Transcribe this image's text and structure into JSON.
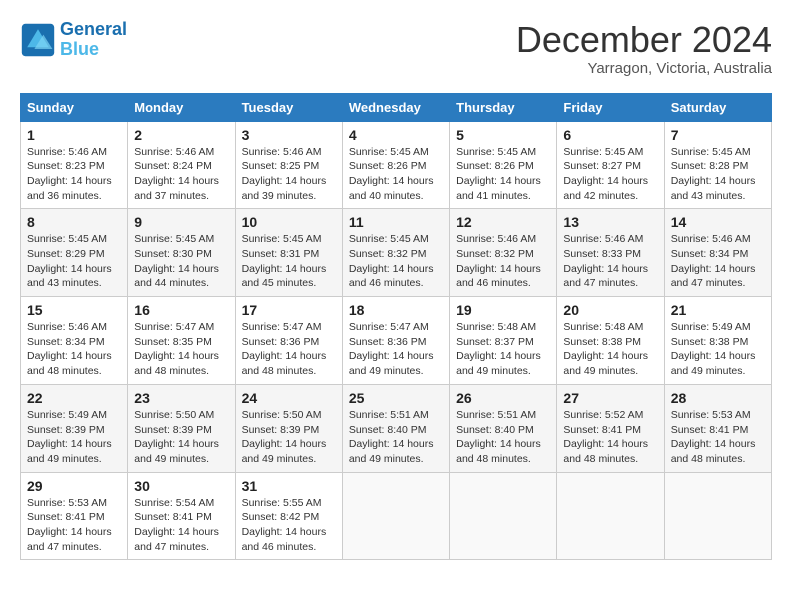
{
  "header": {
    "logo_line1": "General",
    "logo_line2": "Blue",
    "month_title": "December 2024",
    "location": "Yarragon, Victoria, Australia"
  },
  "days_of_week": [
    "Sunday",
    "Monday",
    "Tuesday",
    "Wednesday",
    "Thursday",
    "Friday",
    "Saturday"
  ],
  "weeks": [
    [
      {
        "day": "1",
        "lines": [
          "Sunrise: 5:46 AM",
          "Sunset: 8:23 PM",
          "Daylight: 14 hours",
          "and 36 minutes."
        ]
      },
      {
        "day": "2",
        "lines": [
          "Sunrise: 5:46 AM",
          "Sunset: 8:24 PM",
          "Daylight: 14 hours",
          "and 37 minutes."
        ]
      },
      {
        "day": "3",
        "lines": [
          "Sunrise: 5:46 AM",
          "Sunset: 8:25 PM",
          "Daylight: 14 hours",
          "and 39 minutes."
        ]
      },
      {
        "day": "4",
        "lines": [
          "Sunrise: 5:45 AM",
          "Sunset: 8:26 PM",
          "Daylight: 14 hours",
          "and 40 minutes."
        ]
      },
      {
        "day": "5",
        "lines": [
          "Sunrise: 5:45 AM",
          "Sunset: 8:26 PM",
          "Daylight: 14 hours",
          "and 41 minutes."
        ]
      },
      {
        "day": "6",
        "lines": [
          "Sunrise: 5:45 AM",
          "Sunset: 8:27 PM",
          "Daylight: 14 hours",
          "and 42 minutes."
        ]
      },
      {
        "day": "7",
        "lines": [
          "Sunrise: 5:45 AM",
          "Sunset: 8:28 PM",
          "Daylight: 14 hours",
          "and 43 minutes."
        ]
      }
    ],
    [
      {
        "day": "8",
        "lines": [
          "Sunrise: 5:45 AM",
          "Sunset: 8:29 PM",
          "Daylight: 14 hours",
          "and 43 minutes."
        ]
      },
      {
        "day": "9",
        "lines": [
          "Sunrise: 5:45 AM",
          "Sunset: 8:30 PM",
          "Daylight: 14 hours",
          "and 44 minutes."
        ]
      },
      {
        "day": "10",
        "lines": [
          "Sunrise: 5:45 AM",
          "Sunset: 8:31 PM",
          "Daylight: 14 hours",
          "and 45 minutes."
        ]
      },
      {
        "day": "11",
        "lines": [
          "Sunrise: 5:45 AM",
          "Sunset: 8:32 PM",
          "Daylight: 14 hours",
          "and 46 minutes."
        ]
      },
      {
        "day": "12",
        "lines": [
          "Sunrise: 5:46 AM",
          "Sunset: 8:32 PM",
          "Daylight: 14 hours",
          "and 46 minutes."
        ]
      },
      {
        "day": "13",
        "lines": [
          "Sunrise: 5:46 AM",
          "Sunset: 8:33 PM",
          "Daylight: 14 hours",
          "and 47 minutes."
        ]
      },
      {
        "day": "14",
        "lines": [
          "Sunrise: 5:46 AM",
          "Sunset: 8:34 PM",
          "Daylight: 14 hours",
          "and 47 minutes."
        ]
      }
    ],
    [
      {
        "day": "15",
        "lines": [
          "Sunrise: 5:46 AM",
          "Sunset: 8:34 PM",
          "Daylight: 14 hours",
          "and 48 minutes."
        ]
      },
      {
        "day": "16",
        "lines": [
          "Sunrise: 5:47 AM",
          "Sunset: 8:35 PM",
          "Daylight: 14 hours",
          "and 48 minutes."
        ]
      },
      {
        "day": "17",
        "lines": [
          "Sunrise: 5:47 AM",
          "Sunset: 8:36 PM",
          "Daylight: 14 hours",
          "and 48 minutes."
        ]
      },
      {
        "day": "18",
        "lines": [
          "Sunrise: 5:47 AM",
          "Sunset: 8:36 PM",
          "Daylight: 14 hours",
          "and 49 minutes."
        ]
      },
      {
        "day": "19",
        "lines": [
          "Sunrise: 5:48 AM",
          "Sunset: 8:37 PM",
          "Daylight: 14 hours",
          "and 49 minutes."
        ]
      },
      {
        "day": "20",
        "lines": [
          "Sunrise: 5:48 AM",
          "Sunset: 8:38 PM",
          "Daylight: 14 hours",
          "and 49 minutes."
        ]
      },
      {
        "day": "21",
        "lines": [
          "Sunrise: 5:49 AM",
          "Sunset: 8:38 PM",
          "Daylight: 14 hours",
          "and 49 minutes."
        ]
      }
    ],
    [
      {
        "day": "22",
        "lines": [
          "Sunrise: 5:49 AM",
          "Sunset: 8:39 PM",
          "Daylight: 14 hours",
          "and 49 minutes."
        ]
      },
      {
        "day": "23",
        "lines": [
          "Sunrise: 5:50 AM",
          "Sunset: 8:39 PM",
          "Daylight: 14 hours",
          "and 49 minutes."
        ]
      },
      {
        "day": "24",
        "lines": [
          "Sunrise: 5:50 AM",
          "Sunset: 8:39 PM",
          "Daylight: 14 hours",
          "and 49 minutes."
        ]
      },
      {
        "day": "25",
        "lines": [
          "Sunrise: 5:51 AM",
          "Sunset: 8:40 PM",
          "Daylight: 14 hours",
          "and 49 minutes."
        ]
      },
      {
        "day": "26",
        "lines": [
          "Sunrise: 5:51 AM",
          "Sunset: 8:40 PM",
          "Daylight: 14 hours",
          "and 48 minutes."
        ]
      },
      {
        "day": "27",
        "lines": [
          "Sunrise: 5:52 AM",
          "Sunset: 8:41 PM",
          "Daylight: 14 hours",
          "and 48 minutes."
        ]
      },
      {
        "day": "28",
        "lines": [
          "Sunrise: 5:53 AM",
          "Sunset: 8:41 PM",
          "Daylight: 14 hours",
          "and 48 minutes."
        ]
      }
    ],
    [
      {
        "day": "29",
        "lines": [
          "Sunrise: 5:53 AM",
          "Sunset: 8:41 PM",
          "Daylight: 14 hours",
          "and 47 minutes."
        ]
      },
      {
        "day": "30",
        "lines": [
          "Sunrise: 5:54 AM",
          "Sunset: 8:41 PM",
          "Daylight: 14 hours",
          "and 47 minutes."
        ]
      },
      {
        "day": "31",
        "lines": [
          "Sunrise: 5:55 AM",
          "Sunset: 8:42 PM",
          "Daylight: 14 hours",
          "and 46 minutes."
        ]
      },
      {
        "day": "",
        "lines": []
      },
      {
        "day": "",
        "lines": []
      },
      {
        "day": "",
        "lines": []
      },
      {
        "day": "",
        "lines": []
      }
    ]
  ]
}
